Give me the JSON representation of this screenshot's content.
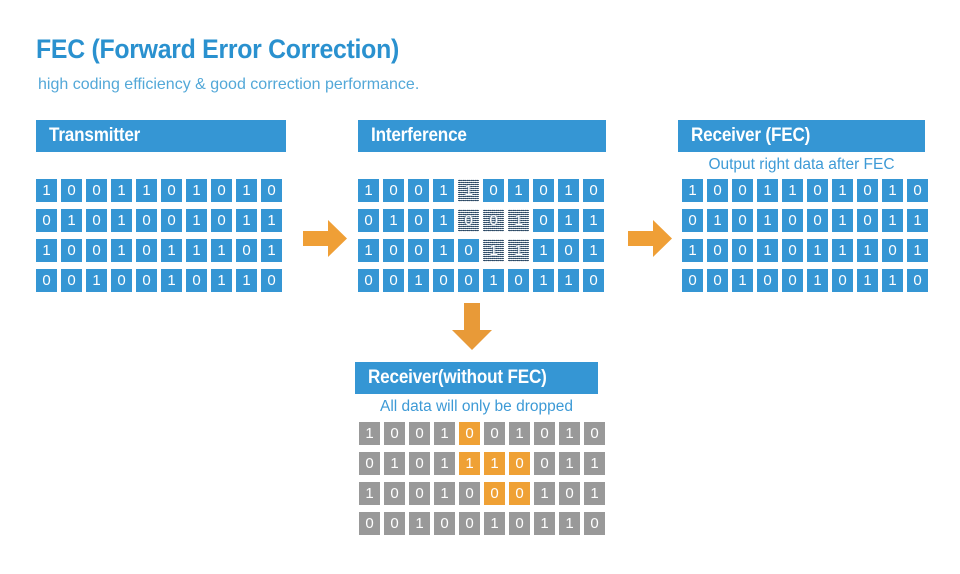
{
  "title": "FEC (Forward Error Correction)",
  "subtitle": "high coding efficiency & good correction performance.",
  "colors": {
    "blue": "#3596d4",
    "title_blue": "#2a91cf",
    "caption_blue": "#3d9ad6",
    "orange": "#efa135",
    "grey": "#999999",
    "white": "#ffffff"
  },
  "panels": {
    "transmitter": {
      "header": "Transmitter",
      "caption": "",
      "rows": [
        [
          "1",
          "0",
          "0",
          "1",
          "1",
          "0",
          "1",
          "0",
          "1",
          "0"
        ],
        [
          "0",
          "1",
          "0",
          "1",
          "0",
          "0",
          "1",
          "0",
          "1",
          "1"
        ],
        [
          "1",
          "0",
          "0",
          "1",
          "0",
          "1",
          "1",
          "1",
          "0",
          "1"
        ],
        [
          "0",
          "0",
          "1",
          "0",
          "0",
          "1",
          "0",
          "1",
          "1",
          "0"
        ]
      ],
      "styles": [
        [
          "b",
          "b",
          "b",
          "b",
          "b",
          "b",
          "b",
          "b",
          "b",
          "b"
        ],
        [
          "b",
          "b",
          "b",
          "b",
          "b",
          "b",
          "b",
          "b",
          "b",
          "b"
        ],
        [
          "b",
          "b",
          "b",
          "b",
          "b",
          "b",
          "b",
          "b",
          "b",
          "b"
        ],
        [
          "b",
          "b",
          "b",
          "b",
          "b",
          "b",
          "b",
          "b",
          "b",
          "b"
        ]
      ]
    },
    "interference": {
      "header": "Interference",
      "caption": "",
      "rows": [
        [
          "1",
          "0",
          "0",
          "1",
          "1",
          "0",
          "1",
          "0",
          "1",
          "0"
        ],
        [
          "0",
          "1",
          "0",
          "1",
          "0",
          "0",
          "1",
          "0",
          "1",
          "1"
        ],
        [
          "1",
          "0",
          "0",
          "1",
          "0",
          "1",
          "1",
          "1",
          "0",
          "1"
        ],
        [
          "0",
          "0",
          "1",
          "0",
          "0",
          "1",
          "0",
          "1",
          "1",
          "0"
        ]
      ],
      "styles": [
        [
          "b",
          "b",
          "b",
          "b",
          "n",
          "b",
          "b",
          "b",
          "b",
          "b"
        ],
        [
          "b",
          "b",
          "b",
          "b",
          "n",
          "n",
          "n",
          "b",
          "b",
          "b"
        ],
        [
          "b",
          "b",
          "b",
          "b",
          "b",
          "n",
          "n",
          "b",
          "b",
          "b"
        ],
        [
          "b",
          "b",
          "b",
          "b",
          "b",
          "b",
          "b",
          "b",
          "b",
          "b"
        ]
      ]
    },
    "receiver_fec": {
      "header": "Receiver (FEC)",
      "caption": "Output right data after FEC",
      "rows": [
        [
          "1",
          "0",
          "0",
          "1",
          "1",
          "0",
          "1",
          "0",
          "1",
          "0"
        ],
        [
          "0",
          "1",
          "0",
          "1",
          "0",
          "0",
          "1",
          "0",
          "1",
          "1"
        ],
        [
          "1",
          "0",
          "0",
          "1",
          "0",
          "1",
          "1",
          "1",
          "0",
          "1"
        ],
        [
          "0",
          "0",
          "1",
          "0",
          "0",
          "1",
          "0",
          "1",
          "1",
          "0"
        ]
      ],
      "styles": [
        [
          "b",
          "b",
          "b",
          "b",
          "b",
          "b",
          "b",
          "b",
          "b",
          "b"
        ],
        [
          "b",
          "b",
          "b",
          "b",
          "b",
          "b",
          "b",
          "b",
          "b",
          "b"
        ],
        [
          "b",
          "b",
          "b",
          "b",
          "b",
          "b",
          "b",
          "b",
          "b",
          "b"
        ],
        [
          "b",
          "b",
          "b",
          "b",
          "b",
          "b",
          "b",
          "b",
          "b",
          "b"
        ]
      ]
    },
    "receiver_no_fec": {
      "header": "Receiver(without FEC)",
      "caption": "All data will only be dropped",
      "rows": [
        [
          "1",
          "0",
          "0",
          "1",
          "0",
          "0",
          "1",
          "0",
          "1",
          "0"
        ],
        [
          "0",
          "1",
          "0",
          "1",
          "1",
          "1",
          "0",
          "0",
          "1",
          "1"
        ],
        [
          "1",
          "0",
          "0",
          "1",
          "0",
          "0",
          "0",
          "1",
          "0",
          "1"
        ],
        [
          "0",
          "0",
          "1",
          "0",
          "0",
          "1",
          "0",
          "1",
          "1",
          "0"
        ]
      ],
      "styles": [
        [
          "g",
          "g",
          "g",
          "g",
          "o",
          "g",
          "g",
          "g",
          "g",
          "g"
        ],
        [
          "g",
          "g",
          "g",
          "g",
          "o",
          "o",
          "o",
          "g",
          "g",
          "g"
        ],
        [
          "g",
          "g",
          "g",
          "g",
          "g",
          "o",
          "o",
          "g",
          "g",
          "g"
        ],
        [
          "g",
          "g",
          "g",
          "g",
          "g",
          "g",
          "g",
          "g",
          "g",
          "g"
        ]
      ]
    }
  },
  "arrows": [
    {
      "name": "arrow-transmitter-to-interference",
      "direction": "right"
    },
    {
      "name": "arrow-interference-to-receiver-fec",
      "direction": "right"
    },
    {
      "name": "arrow-interference-to-receiver-no-fec",
      "direction": "down"
    }
  ]
}
